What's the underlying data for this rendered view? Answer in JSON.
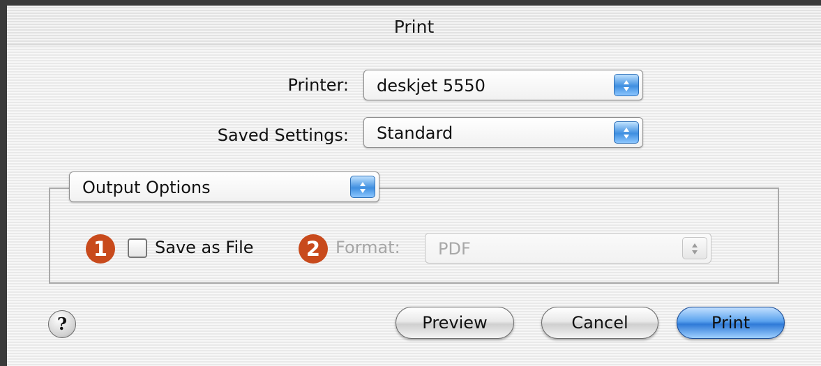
{
  "window": {
    "title": "Print"
  },
  "printer": {
    "label": "Printer:",
    "value": "deskjet 5550"
  },
  "saved_settings": {
    "label": "Saved Settings:",
    "value": "Standard"
  },
  "panel": {
    "value": "Output Options"
  },
  "output_options": {
    "badge1": "1",
    "save_as_file_label": "Save as File",
    "save_as_file_checked": false,
    "badge2": "2",
    "format_label": "Format:",
    "format_value": "PDF",
    "format_enabled": false
  },
  "help": {
    "glyph": "?"
  },
  "buttons": {
    "preview": "Preview",
    "cancel": "Cancel",
    "print": "Print"
  },
  "colors": {
    "accent": "#3f8fe0",
    "badge": "#c84a1c",
    "disabled_text": "#a6a6a6"
  }
}
